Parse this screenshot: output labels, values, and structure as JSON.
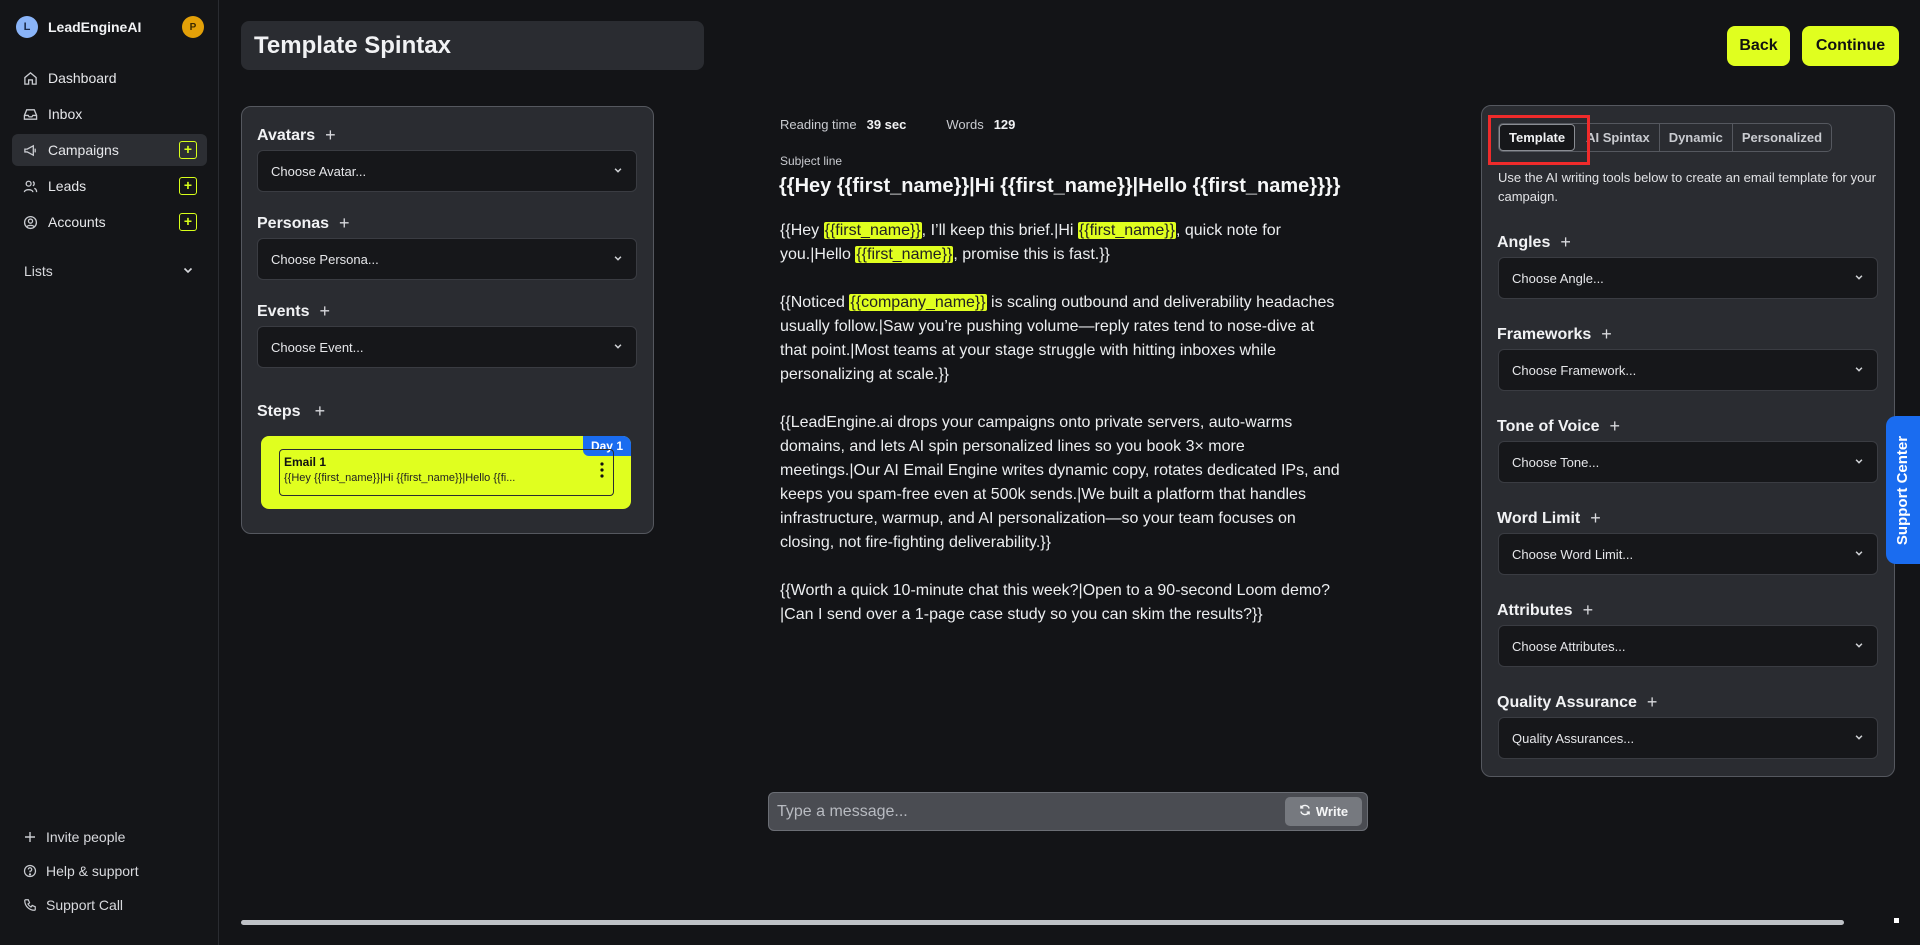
{
  "brand": {
    "logo_letter": "L",
    "name": "LeadEngineAI",
    "user_initial": "P"
  },
  "nav": {
    "items": [
      {
        "label": "Dashboard"
      },
      {
        "label": "Inbox"
      },
      {
        "label": "Campaigns"
      },
      {
        "label": "Leads"
      },
      {
        "label": "Accounts"
      }
    ],
    "lists_label": "Lists",
    "bottom": [
      {
        "label": "Invite people"
      },
      {
        "label": "Help & support"
      },
      {
        "label": "Support Call"
      }
    ]
  },
  "header": {
    "title": "Template Spintax",
    "back_label": "Back",
    "continue_label": "Continue"
  },
  "left_panel": {
    "avatars": {
      "label": "Avatars",
      "placeholder": "Choose Avatar..."
    },
    "personas": {
      "label": "Personas",
      "placeholder": "Choose Persona..."
    },
    "events": {
      "label": "Events",
      "placeholder": "Choose Event..."
    },
    "steps": {
      "label": "Steps",
      "items": [
        {
          "title": "Email 1",
          "preview": "{{Hey {{first_name}}|Hi {{first_name}}|Hello {{fi...",
          "badge": "Day 1"
        }
      ]
    }
  },
  "editor": {
    "reading_time_label": "Reading time",
    "reading_time_value": "39 sec",
    "words_label": "Words",
    "words_value": "129",
    "subject_label": "Subject line",
    "subject": "{{Hey {{first_name}}|Hi {{first_name}}|Hello {{first_name}}}}",
    "p1": {
      "a": "{{Hey ",
      "h1": "{{first_name}}",
      "b": ", I’ll keep this brief.|Hi ",
      "h2": "{{first_name}}",
      "c": ", quick note for you.|Hello ",
      "h3": "{{first_name}}",
      "d": ", promise this is fast.}}"
    },
    "p2": {
      "a": "{{Noticed ",
      "h1": "{{company_name}}",
      "b": " is scaling outbound and deliverability headaches usually follow.|Saw you’re pushing volume—reply rates tend to nose-dive at that point.|Most teams at your stage struggle with hitting inboxes while personalizing at scale.}}"
    },
    "p3": "{{LeadEngine.ai drops your campaigns onto private servers, auto-warms domains, and lets AI spin personalized lines so you book 3× more meetings.|Our AI Email Engine writes dynamic copy, rotates dedicated IPs, and keeps you spam-free even at 500k sends.|We built a platform that handles infrastructure, warmup, and AI personalization—so your team focuses on closing, not fire-fighting deliverability.}}",
    "p4": "{{Worth a quick 10-minute chat this week?|Open to a 90-second Loom demo?|Can I send over a 1-page case study so you can skim the results?}}"
  },
  "composer": {
    "placeholder": "Type a message...",
    "write_label": "Write"
  },
  "right_panel": {
    "tabs": [
      {
        "label": "Template",
        "active": true
      },
      {
        "label": "AI Spintax"
      },
      {
        "label": "Dynamic"
      },
      {
        "label": "Personalized"
      }
    ],
    "description": "Use the AI writing tools below to create an email template for your campaign.",
    "sections": [
      {
        "label": "Angles",
        "placeholder": "Choose Angle..."
      },
      {
        "label": "Frameworks",
        "placeholder": "Choose Framework..."
      },
      {
        "label": "Tone of Voice",
        "placeholder": "Choose Tone..."
      },
      {
        "label": "Word Limit",
        "placeholder": "Choose Word Limit..."
      },
      {
        "label": "Attributes",
        "placeholder": "Choose Attributes..."
      },
      {
        "label": "Quality Assurance",
        "placeholder": "Quality Assurances..."
      }
    ]
  },
  "support_tab": {
    "label": "Support Center"
  },
  "colors": {
    "accent": "#e0ff1f",
    "badge_blue": "#1a6cf0",
    "highlight_box": "#ef2b2b"
  }
}
